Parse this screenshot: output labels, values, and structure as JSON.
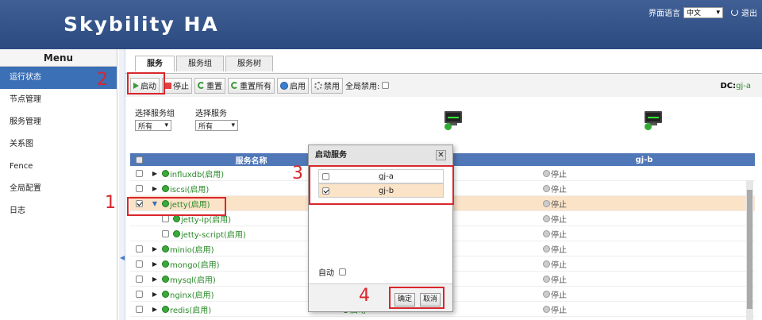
{
  "header": {
    "title": "Skybility HA",
    "lang_label": "界面语言",
    "lang_value": "中文",
    "logout": "退出"
  },
  "sidebar": {
    "title": "Menu",
    "items": [
      "运行状态",
      "节点管理",
      "服务管理",
      "关系图",
      "Fence",
      "全局配置",
      "日志"
    ]
  },
  "tabs": [
    "服务",
    "服务组",
    "服务树"
  ],
  "toolbar": {
    "start": "启动",
    "stop": "停止",
    "reset": "重置",
    "reset_all": "重置所有",
    "enable": "启用",
    "disable": "禁用",
    "global_disable": "全局禁用:"
  },
  "dc": {
    "label": "DC:",
    "value": "gj-a"
  },
  "filters": {
    "group_label": "选择服务组",
    "group_value": "所有",
    "service_label": "选择服务",
    "service_value": "所有"
  },
  "table": {
    "col_name": "服务名称",
    "col_a": "-a",
    "col_b": "gj-b",
    "rows": [
      {
        "name": "influxdb(启用)",
        "b": "停止"
      },
      {
        "name": "iscsi(启用)",
        "b": "停止"
      },
      {
        "name": "jetty(启用)",
        "b": "停止"
      },
      {
        "name": "jetty-ip(启用)",
        "b": "停止"
      },
      {
        "name": "jetty-script(启用)",
        "b": "停止"
      },
      {
        "name": "minio(启用)",
        "b": "停止"
      },
      {
        "name": "mongo(启用)",
        "b": "停止"
      },
      {
        "name": "mysql(启用)",
        "b": "停止"
      },
      {
        "name": "nginx(启用)",
        "b": "停止"
      },
      {
        "name": "redis(启用)",
        "b": "停止"
      }
    ],
    "partial_a": "启动"
  },
  "dialog": {
    "title": "启动服务",
    "close": "✕",
    "nodes": [
      "gj-a",
      "gj-b"
    ],
    "auto_label": "自动",
    "ok": "确定",
    "cancel": "取消"
  },
  "annotations": [
    "1",
    "2",
    "3",
    "4"
  ]
}
